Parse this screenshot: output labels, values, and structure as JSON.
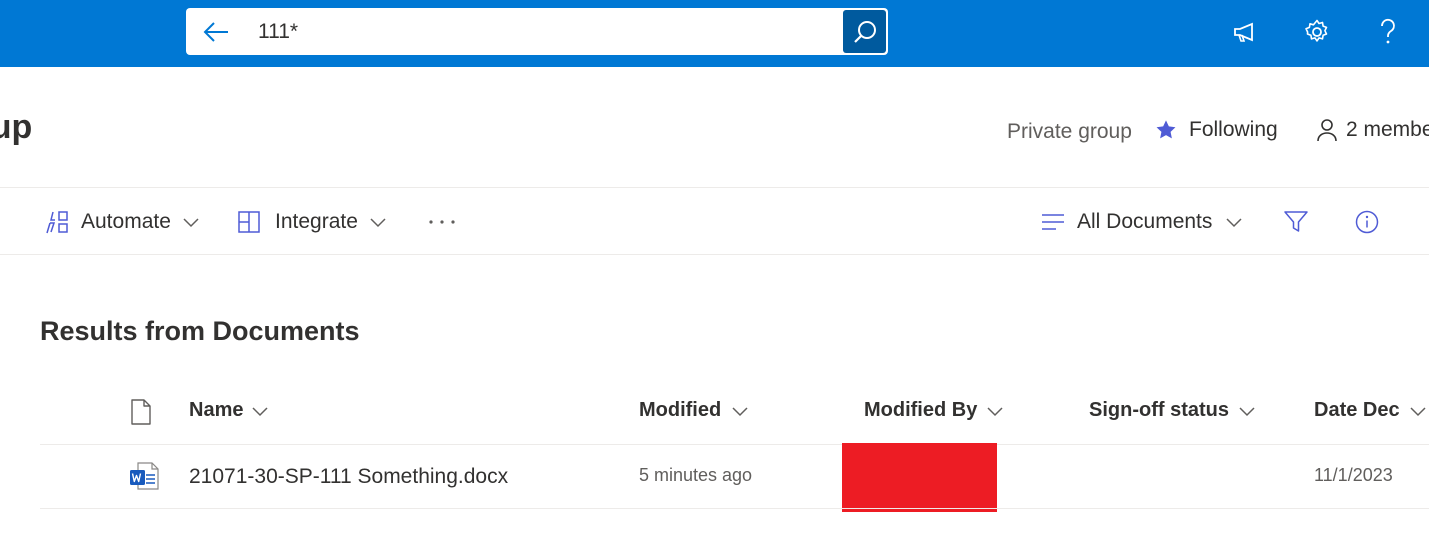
{
  "search": {
    "query": "111*"
  },
  "site": {
    "title_fragment": "oup",
    "privacy": "Private group",
    "following_label": "Following",
    "members_label": "2 membe"
  },
  "commands": {
    "automate": "Automate",
    "integrate": "Integrate",
    "more": "···",
    "view": "All Documents"
  },
  "results": {
    "title": "Results from Documents",
    "columns": [
      "Name",
      "Modified",
      "Modified By",
      "Sign-off status",
      "Date Dec"
    ],
    "rows": [
      {
        "name": "21071-30-SP-111 Something.docx",
        "modified": "5 minutes ago",
        "modified_by": "",
        "signoff": "",
        "date": "11/1/2023",
        "file_icon": "word-doc-icon"
      }
    ]
  },
  "colors": {
    "suite_bar": "#0078d4",
    "search_button": "#005a9e",
    "accent": "#4f5bd5",
    "redaction": "#ed1c24"
  }
}
